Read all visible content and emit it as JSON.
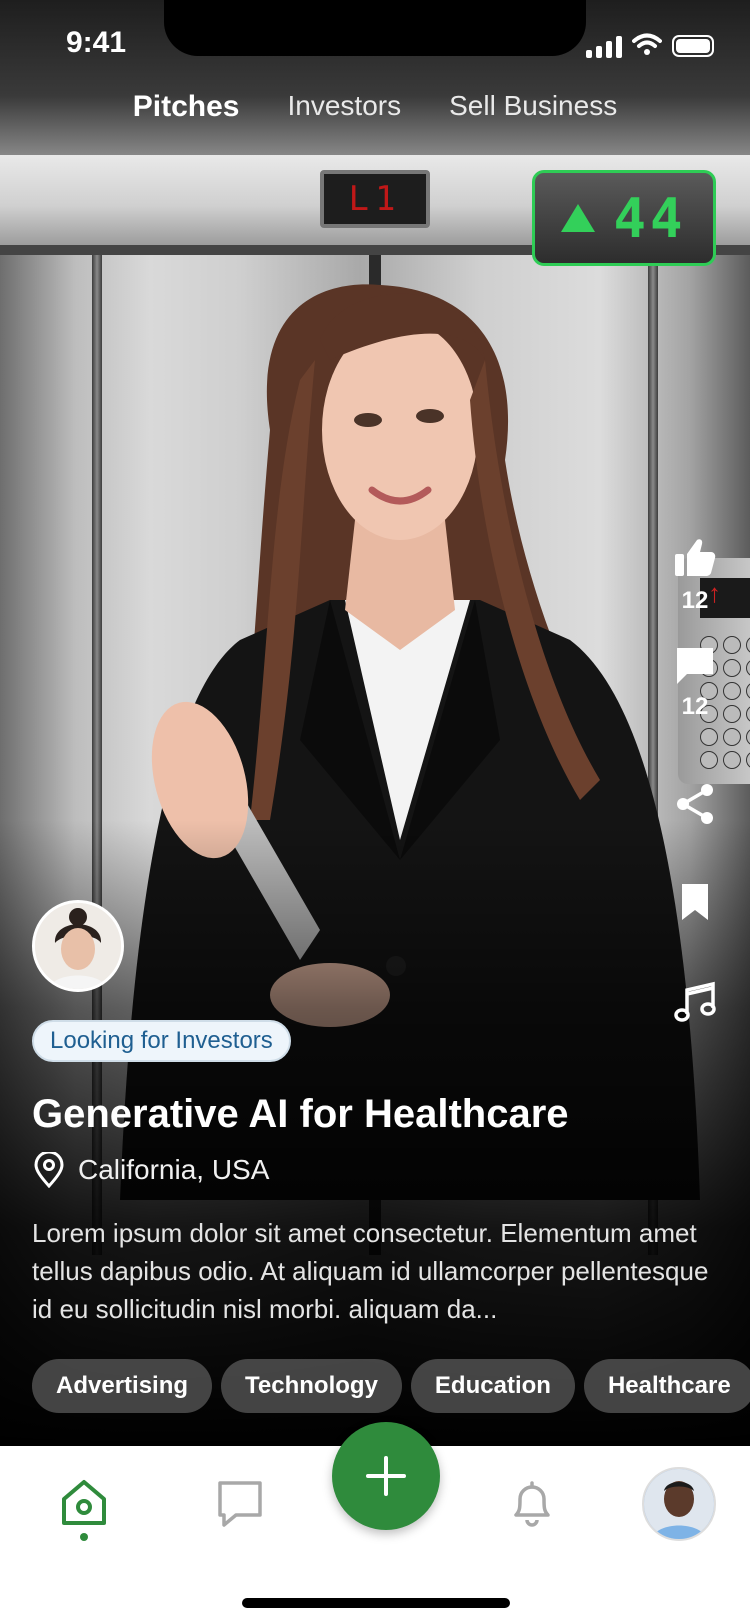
{
  "status_bar": {
    "time": "9:41"
  },
  "top_tabs": [
    {
      "label": "Pitches",
      "active": true
    },
    {
      "label": "Investors",
      "active": false
    },
    {
      "label": "Sell Business",
      "active": false
    }
  ],
  "scene": {
    "floor_display": "L1",
    "floor_counter": "44"
  },
  "actions": {
    "likes": "12",
    "comments": "12"
  },
  "pitch": {
    "status_badge": "Looking for Investors",
    "title": "Generative AI for Healthcare",
    "location": "California, USA",
    "description": "Lorem ipsum dolor sit amet consectetur. Elementum amet tellus dapibus odio. At aliquam id ullamcorper pellentesque id eu sollicitudin nisl morbi. aliquam da...",
    "tags": [
      "Advertising",
      "Technology",
      "Education",
      "Healthcare"
    ]
  },
  "bottom_nav": {
    "items": [
      "home-icon",
      "chat-icon",
      "add-icon",
      "bell-icon",
      "profile-avatar"
    ],
    "active": "home-icon"
  },
  "colors": {
    "accent_green": "#2f8b3c",
    "counter_green": "#33d05a",
    "badge_text": "#1f5f91"
  }
}
